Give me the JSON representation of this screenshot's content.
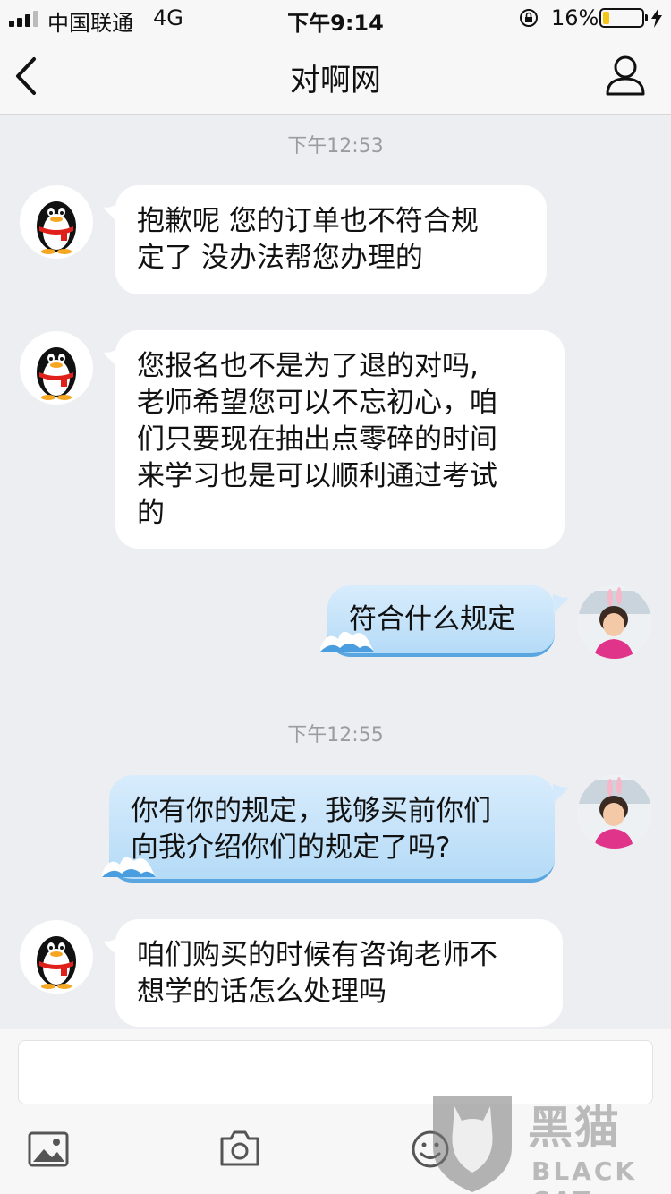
{
  "status_bar": {
    "carrier": "中国联通",
    "network": "4G",
    "time": "下午9:14",
    "battery_percent": "16%",
    "battery_level": 0.16,
    "battery_color": "#f5c518"
  },
  "header": {
    "title": "对啊网",
    "back_icon": "chevron-left-icon",
    "profile_icon": "person-icon"
  },
  "messages": [
    {
      "type": "timestamp",
      "text": "下午12:53"
    },
    {
      "type": "incoming",
      "avatar": "qq-penguin-avatar",
      "lines": [
        "抱歉呢  您的订单也不符合规",
        "定了  没办法帮您办理的"
      ]
    },
    {
      "type": "incoming",
      "avatar": "qq-penguin-avatar",
      "lines": [
        "您报名也不是为了退的对吗,",
        "老师希望您可以不忘初心，咱",
        "们只要现在抽出点零碎的时间",
        "来学习也是可以顺利通过考试",
        "的"
      ]
    },
    {
      "type": "outgoing",
      "avatar": "user-photo-avatar",
      "lines": [
        "符合什么规定"
      ]
    },
    {
      "type": "timestamp",
      "text": "下午12:55"
    },
    {
      "type": "outgoing",
      "avatar": "user-photo-avatar",
      "lines": [
        "你有你的规定，我够买前你们",
        "向我介绍你们的规定了吗?"
      ]
    },
    {
      "type": "incoming",
      "avatar": "qq-penguin-avatar",
      "lines": [
        "咱们购买的时候有咨询老师不",
        "想学的话怎么处理吗"
      ]
    }
  ],
  "input_bar": {
    "placeholder": "",
    "tools": [
      "image-icon",
      "camera-icon",
      "emoji-icon"
    ]
  },
  "watermark": {
    "chinese": "黑猫",
    "english": "BLACK CAT"
  },
  "colors": {
    "background": "#edeef1",
    "outgoing_bubble": "#b5dbf7",
    "incoming_bubble": "#ffffff"
  }
}
